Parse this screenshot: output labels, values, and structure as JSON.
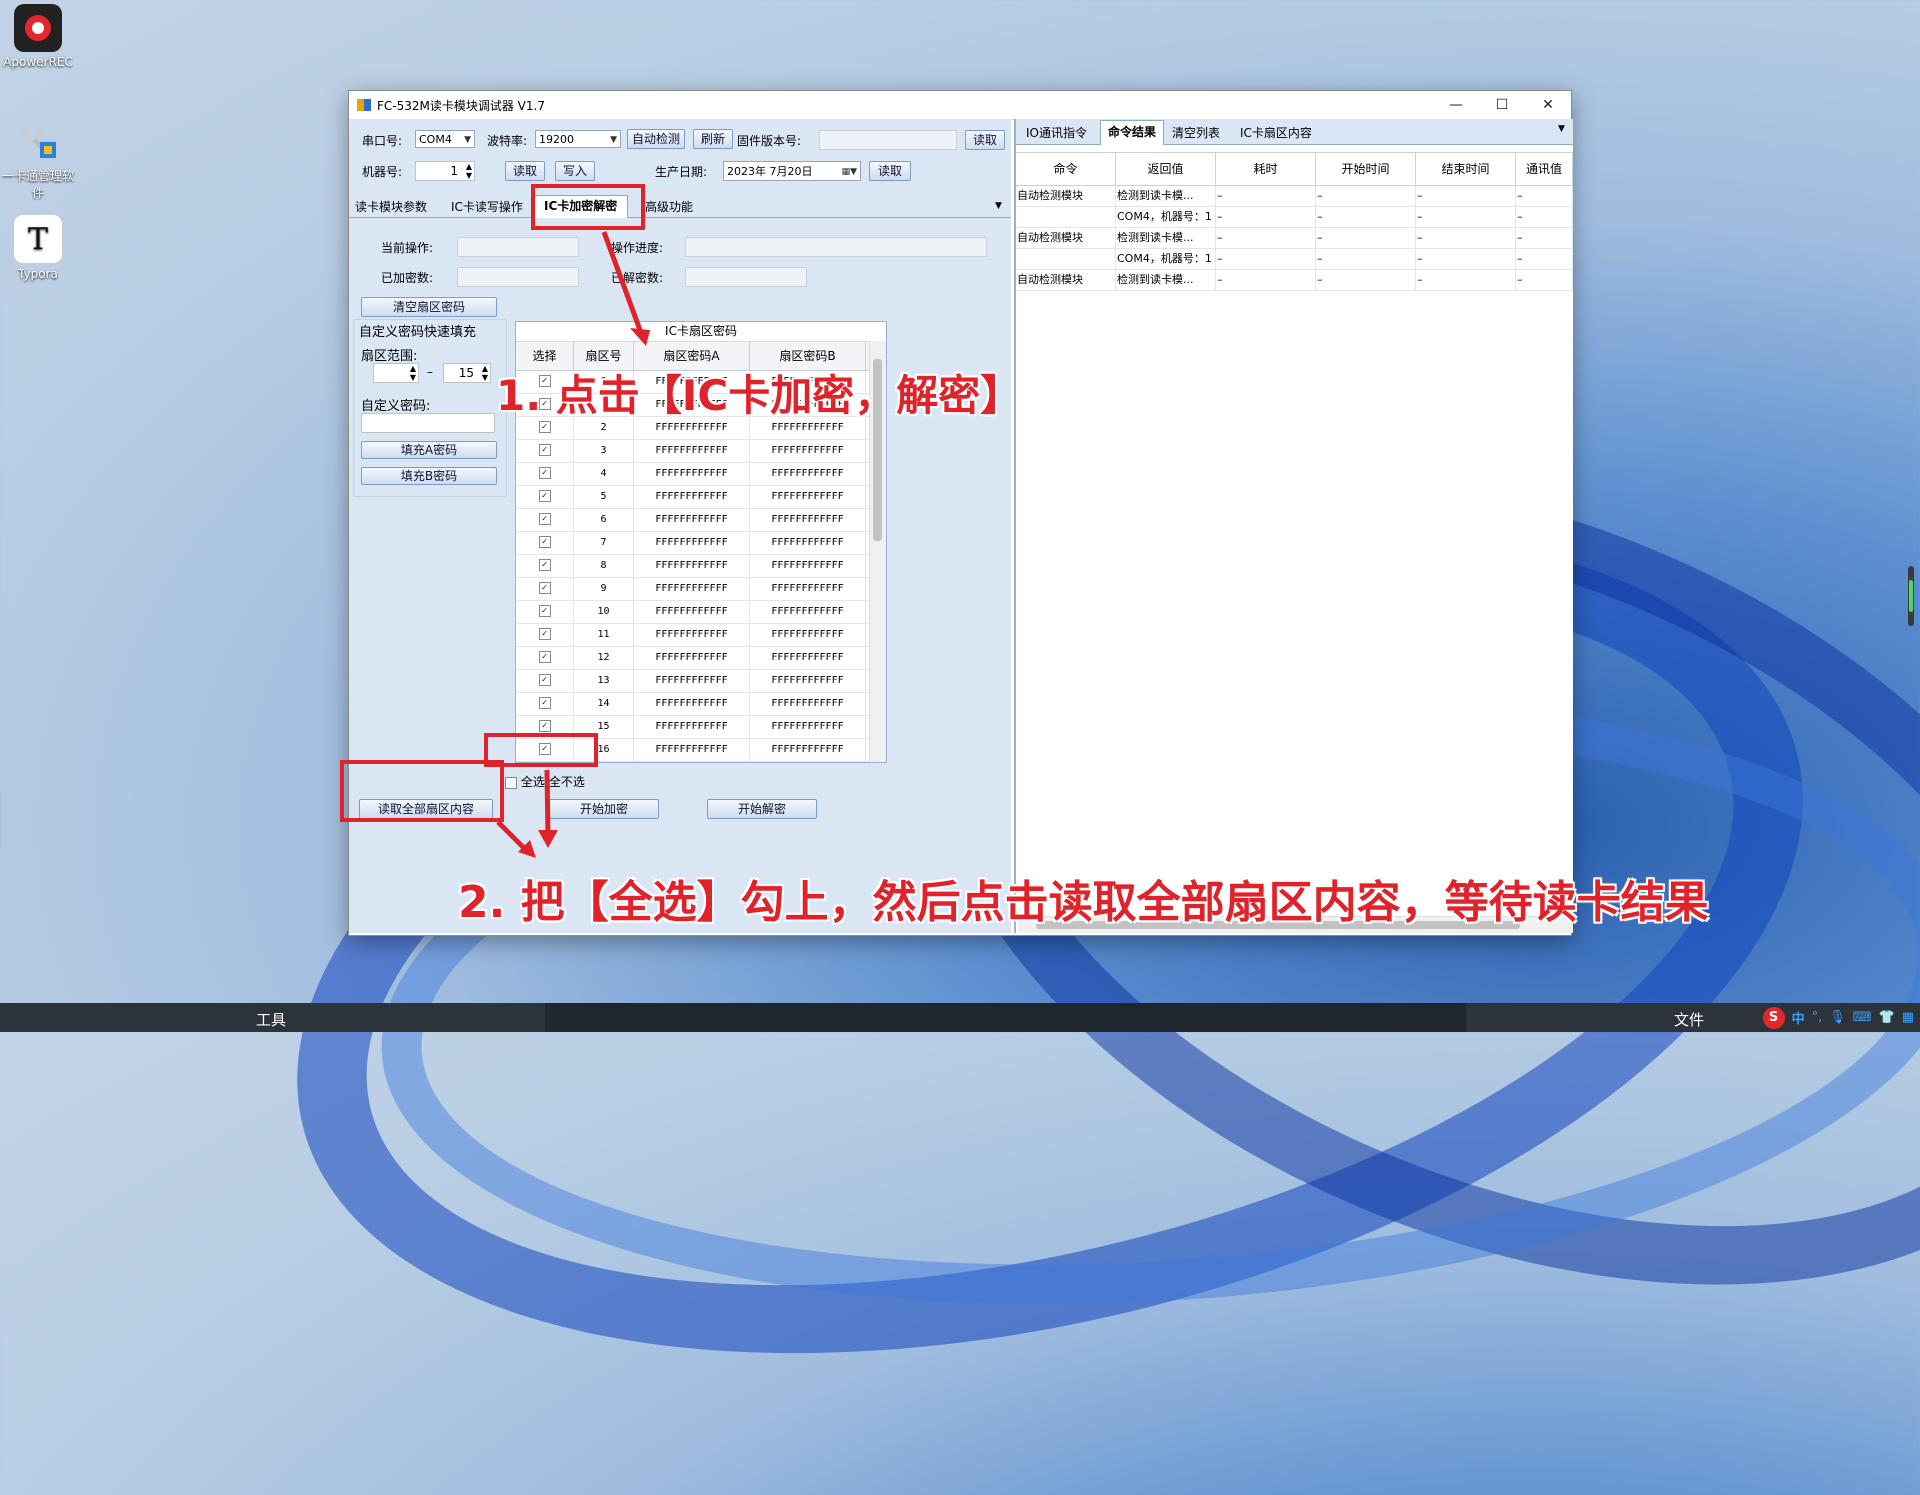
{
  "desktop": {
    "icons": [
      {
        "label": "ApowerREC",
        "icon": "record-icon"
      },
      {
        "label": "一卡通管理软件",
        "icon": "keys-icon"
      },
      {
        "label": "Typora",
        "icon": "typora-icon"
      }
    ]
  },
  "window": {
    "title": "FC-532M读卡模块调试器 V1.7",
    "controls": {
      "minimize": "—",
      "maximize": "☐",
      "close": "✕"
    }
  },
  "toolbar": {
    "port_label": "串口号:",
    "port_value": "COM4",
    "baud_label": "波特率:",
    "baud_value": "19200",
    "auto_detect": "自动检测",
    "refresh": "刷新",
    "firmware_label": "固件版本号:",
    "read1": "读取",
    "machine_label": "机器号:",
    "machine_value": "1",
    "read2": "读取",
    "write": "写入",
    "date_label": "生产日期:",
    "date_value": "2023年  7月20日",
    "read3": "读取"
  },
  "tabs": [
    {
      "label": "读卡模块参数"
    },
    {
      "label": "IC卡读写操作"
    },
    {
      "label": "IC卡加密解密"
    },
    {
      "label": "高级功能"
    }
  ],
  "status": {
    "current_op_label": "当前操作:",
    "progress_label": "操作进度:",
    "encrypted_label": "已加密数:",
    "decrypted_label": "已解密数:"
  },
  "fill_panel": {
    "clear_button": "清空扇区密码",
    "title": "自定义密码快速填充",
    "range_label": "扇区范围:",
    "range_to": "15",
    "dash": "–",
    "custom_label": "自定义密码:",
    "fill_a": "填充A密码",
    "fill_b": "填充B密码"
  },
  "grid": {
    "caption": "IC卡扇区密码",
    "headers": [
      "选择",
      "扇区号",
      "扇区密码A",
      "扇区密码B"
    ],
    "rows": [
      {
        "sector": "0",
        "a": "FFFFFFFFFFFF",
        "b": "FFFFFFFFFFFF"
      },
      {
        "sector": "1",
        "a": "FFFFFFFFFFFF",
        "b": "FFFFFFFFFFFF"
      },
      {
        "sector": "2",
        "a": "FFFFFFFFFFFF",
        "b": "FFFFFFFFFFFF"
      },
      {
        "sector": "3",
        "a": "FFFFFFFFFFFF",
        "b": "FFFFFFFFFFFF"
      },
      {
        "sector": "4",
        "a": "FFFFFFFFFFFF",
        "b": "FFFFFFFFFFFF"
      },
      {
        "sector": "5",
        "a": "FFFFFFFFFFFF",
        "b": "FFFFFFFFFFFF"
      },
      {
        "sector": "6",
        "a": "FFFFFFFFFFFF",
        "b": "FFFFFFFFFFFF"
      },
      {
        "sector": "7",
        "a": "FFFFFFFFFFFF",
        "b": "FFFFFFFFFFFF"
      },
      {
        "sector": "8",
        "a": "FFFFFFFFFFFF",
        "b": "FFFFFFFFFFFF"
      },
      {
        "sector": "9",
        "a": "FFFFFFFFFFFF",
        "b": "FFFFFFFFFFFF"
      },
      {
        "sector": "10",
        "a": "FFFFFFFFFFFF",
        "b": "FFFFFFFFFFFF"
      },
      {
        "sector": "11",
        "a": "FFFFFFFFFFFF",
        "b": "FFFFFFFFFFFF"
      },
      {
        "sector": "12",
        "a": "FFFFFFFFFFFF",
        "b": "FFFFFFFFFFFF"
      },
      {
        "sector": "13",
        "a": "FFFFFFFFFFFF",
        "b": "FFFFFFFFFFFF"
      },
      {
        "sector": "14",
        "a": "FFFFFFFFFFFF",
        "b": "FFFFFFFFFFFF"
      },
      {
        "sector": "15",
        "a": "FFFFFFFFFFFF",
        "b": "FFFFFFFFFFFF"
      },
      {
        "sector": "16",
        "a": "FFFFFFFFFFFF",
        "b": "FFFFFFFFFFFF"
      }
    ]
  },
  "bottom": {
    "select_all": "全选/全不选",
    "read_all": "读取全部扇区内容",
    "start_encrypt": "开始加密",
    "start_decrypt": "开始解密"
  },
  "right_panel": {
    "tabs": [
      {
        "label": "IO通讯指令"
      },
      {
        "label": "命令结果"
      },
      {
        "label": "清空列表"
      },
      {
        "label": "IC卡扇区内容"
      }
    ],
    "headers": [
      "命令",
      "返回值",
      "耗时",
      "开始时间",
      "结束时间",
      "通讯值"
    ],
    "rows": [
      [
        "自动检测模块",
        "检测到读卡模...",
        "–",
        "–",
        "–",
        "–"
      ],
      [
        "",
        "COM4，机器号：1",
        "–",
        "–",
        "–",
        "–"
      ],
      [
        "自动检测模块",
        "检测到读卡模...",
        "–",
        "–",
        "–",
        "–"
      ],
      [
        "",
        "COM4，机器号：1",
        "–",
        "–",
        "–",
        "–"
      ],
      [
        "自动检测模块",
        "检测到读卡模...",
        "–",
        "–",
        "–",
        "–"
      ]
    ]
  },
  "annotations": {
    "step1": "1. 点击【IC卡加密，解密】",
    "step2": "2. 把【全选】勾上，然后点击读取全部扇区内容，等待读卡结果",
    "color": "#e0232a"
  },
  "taskbar": {
    "left_item": "工具",
    "right_item": "文件",
    "ime": "中",
    "ime_extra": "°,"
  }
}
